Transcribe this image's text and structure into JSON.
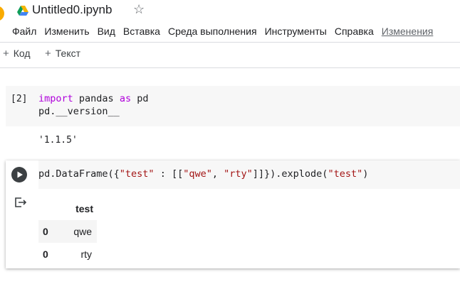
{
  "header": {
    "title": "Untitled0.ipynb",
    "star_glyph": "☆"
  },
  "menu": {
    "items": [
      "Файл",
      "Изменить",
      "Вид",
      "Вставка",
      "Среда выполнения",
      "Инструменты",
      "Справка"
    ],
    "changes_link": "Изменения"
  },
  "toolbar": {
    "add_code": "Код",
    "add_text": "Текст",
    "plus_glyph": "+"
  },
  "cells": {
    "cell1": {
      "execution_count": "[2]",
      "output": "'1.1.5'"
    },
    "cell2": {
      "dataframe": {
        "columns": [
          "test"
        ],
        "rows": [
          {
            "index": "0",
            "value": "qwe"
          },
          {
            "index": "0",
            "value": "rty"
          }
        ]
      }
    }
  },
  "colors": {
    "keyword": "#af00db",
    "string": "#a31515",
    "cell_bg": "#f7f7f7",
    "drive_green": "#0f9d58",
    "drive_yellow": "#f4b400",
    "drive_blue": "#4285f4"
  }
}
